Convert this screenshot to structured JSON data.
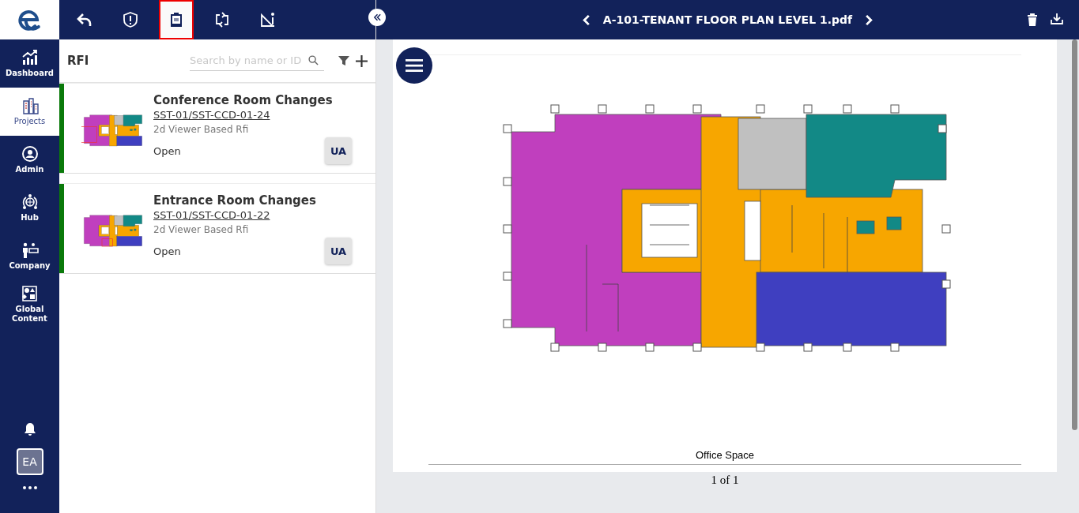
{
  "nav": {
    "items": [
      {
        "label": "Dashboard",
        "selected": false
      },
      {
        "label": "Projects",
        "selected": true
      },
      {
        "label": "Admin",
        "selected": false
      },
      {
        "label": "Hub",
        "selected": false
      },
      {
        "label": "Company",
        "selected": false
      },
      {
        "label": "Global Content",
        "selected": false
      }
    ],
    "avatar": "EA"
  },
  "toolbar": {
    "tools": [
      {
        "selected": false
      },
      {
        "selected": false
      },
      {
        "selected": true
      },
      {
        "selected": false
      },
      {
        "selected": false
      }
    ]
  },
  "panel": {
    "title": "RFI",
    "search": {
      "placeholder": "Search by name or ID"
    },
    "items": [
      {
        "title": "Conference Room Changes",
        "id": "SST-01/SST-CCD-01-24",
        "type": "2d Viewer Based Rfi",
        "status": "Open",
        "assignee": "UA",
        "color": "#0a7a0a"
      },
      {
        "title": "Entrance Room Changes",
        "id": "SST-01/SST-CCD-01-22",
        "type": "2d Viewer Based Rfi",
        "status": "Open",
        "assignee": "UA",
        "color": "#0a7a0a"
      }
    ]
  },
  "viewer": {
    "title": "A-101-TENANT FLOOR PLAN LEVEL 1.pdf",
    "caption": "Office Space",
    "page_indicator": "1 of 1"
  }
}
